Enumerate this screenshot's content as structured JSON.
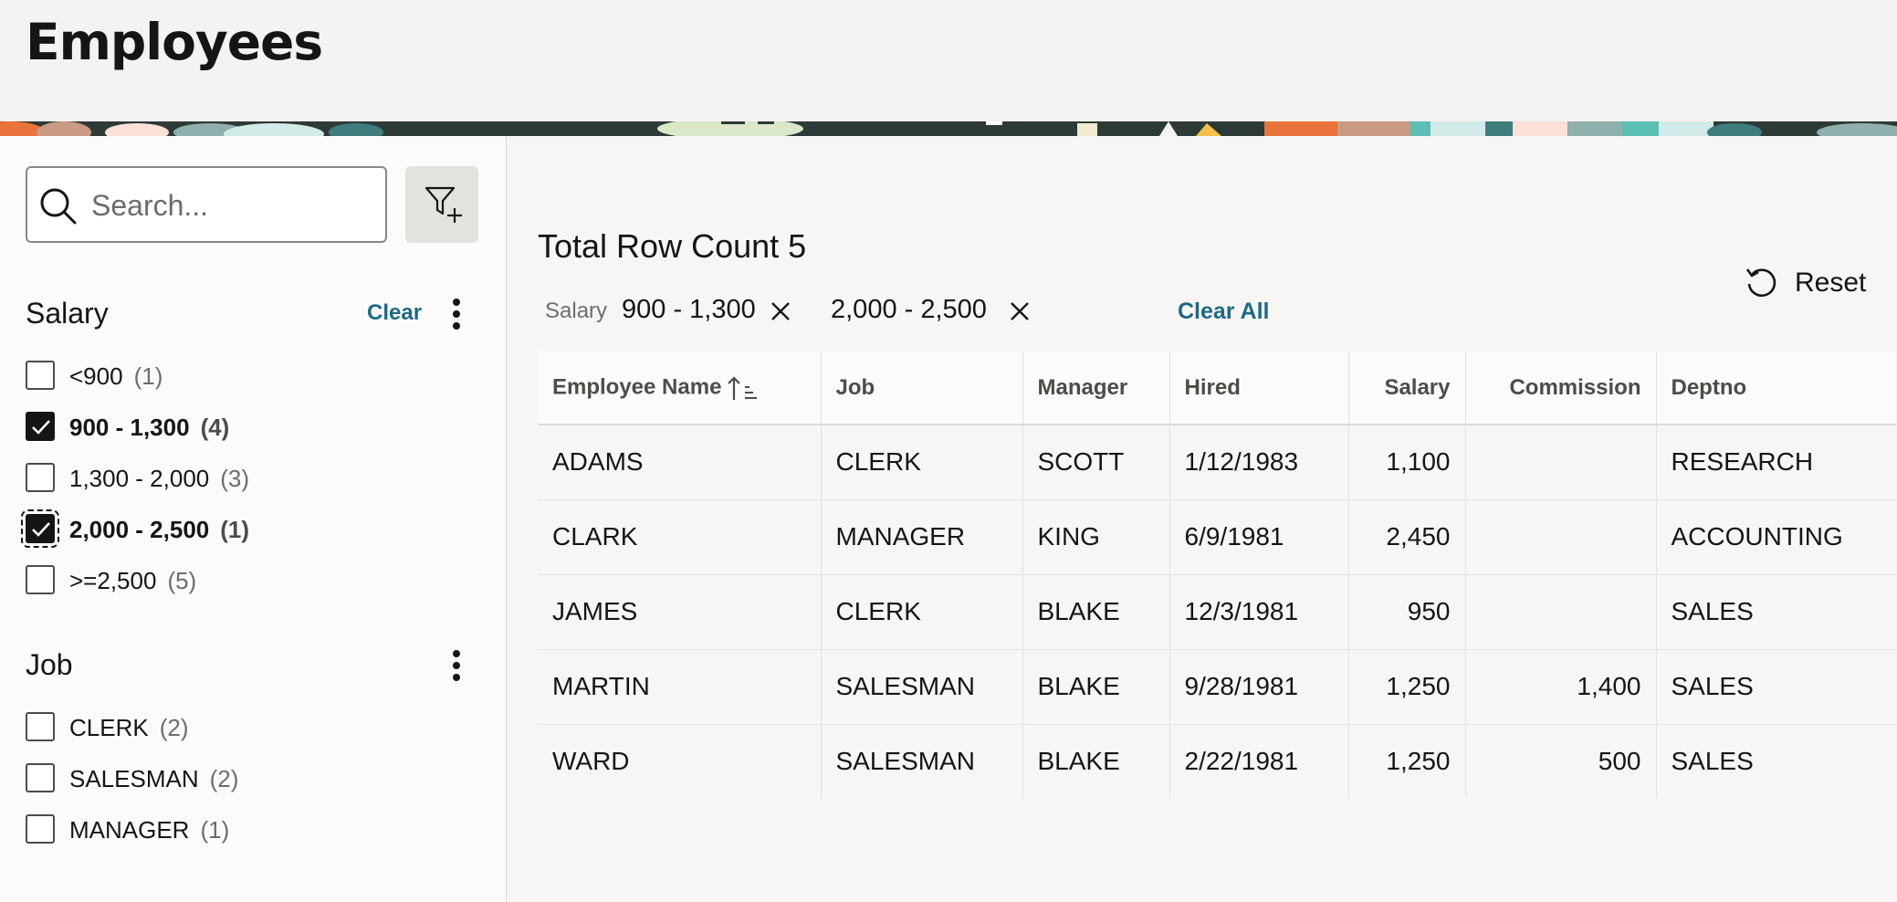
{
  "page": {
    "title": "Employees"
  },
  "search": {
    "placeholder": "Search..."
  },
  "facets": {
    "salary": {
      "title": "Salary",
      "clear_label": "Clear",
      "options": [
        {
          "label": "<900",
          "count": "(1)",
          "checked": false
        },
        {
          "label": "900 - 1,300",
          "count": "(4)",
          "checked": true
        },
        {
          "label": "1,300 - 2,000",
          "count": "(3)",
          "checked": false
        },
        {
          "label": "2,000 - 2,500",
          "count": "(1)",
          "checked": true
        },
        {
          "label": ">=2,500",
          "count": "(5)",
          "checked": false
        }
      ]
    },
    "job": {
      "title": "Job",
      "options": [
        {
          "label": "CLERK",
          "count": "(2)",
          "checked": false
        },
        {
          "label": "SALESMAN",
          "count": "(2)",
          "checked": false
        },
        {
          "label": "MANAGER",
          "count": "(1)",
          "checked": false
        }
      ]
    }
  },
  "results": {
    "row_count": "Total Row Count 5",
    "reset_label": "Reset",
    "chip_caption": "Salary",
    "chips": [
      "900 - 1,300",
      "2,000 - 2,500"
    ],
    "clear_all_label": "Clear All"
  },
  "table": {
    "columns": [
      "Employee Name",
      "Job",
      "Manager",
      "Hired",
      "Salary",
      "Commission",
      "Deptno"
    ],
    "rows": [
      [
        "ADAMS",
        "CLERK",
        "SCOTT",
        "1/12/1983",
        "1,100",
        "",
        "RESEARCH"
      ],
      [
        "CLARK",
        "MANAGER",
        "KING",
        "6/9/1981",
        "2,450",
        "",
        "ACCOUNTING"
      ],
      [
        "JAMES",
        "CLERK",
        "BLAKE",
        "12/3/1981",
        "950",
        "",
        "SALES"
      ],
      [
        "MARTIN",
        "SALESMAN",
        "BLAKE",
        "9/28/1981",
        "1,250",
        "1,400",
        "SALES"
      ],
      [
        "WARD",
        "SALESMAN",
        "BLAKE",
        "2/22/1981",
        "1,250",
        "500",
        "SALES"
      ]
    ]
  },
  "colors": {
    "accent_link": "#1d6a87",
    "text": "#161513",
    "checkbox_checked": "#161513"
  }
}
